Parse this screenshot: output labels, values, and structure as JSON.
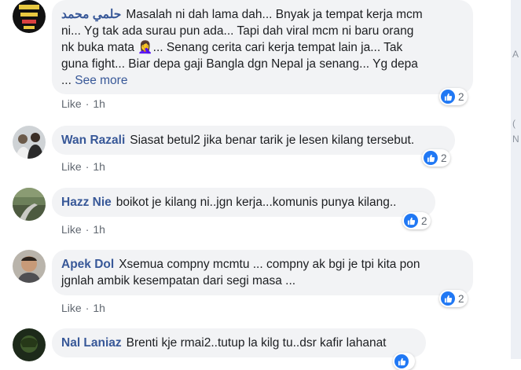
{
  "comments": [
    {
      "author": "حلمي محمد",
      "text_line1": "Masalah ni dah lama dah... Bnyak ja tempat kerja mcm",
      "text_line2": "ni... Yg tak ada surau pun ada... Tapi dah viral mcm ni baru orang",
      "text_line3a": "nk buka mata ",
      "emoji": "🤦‍♀️",
      "text_line3b": "... Senang cerita cari kerja tempat lain ja... Tak",
      "text_line4": "guna fight... Biar depa gaji Bangla dgn Nepal ja senang... Yg depa",
      "text_line5": "...",
      "see_more": "See more",
      "like": "Like",
      "time": "1h",
      "reaction_count": "2"
    },
    {
      "author": "Wan Razali",
      "text": "Siasat betul2 jika benar tarik je lesen kilang tersebut.",
      "like": "Like",
      "time": "1h",
      "reaction_count": "2"
    },
    {
      "author": "Hazz Nie",
      "text": "boikot je kilang ni..jgn kerja...komunis punya kilang..",
      "like": "Like",
      "time": "1h",
      "reaction_count": "2"
    },
    {
      "author": "Apek Dol",
      "text_line1": "Xsemua compny mcmtu ... compny ak bgi je tpi kita pon",
      "text_line2": "jgnlah ambik kesempatan dari segi masa ...",
      "like": "Like",
      "time": "1h",
      "reaction_count": "2"
    },
    {
      "author": "Nal Laniaz",
      "text": "Brenti kje rmai2..tutup la kilg tu..dsr kafir lahanat"
    }
  ],
  "sep": "·",
  "colors": {
    "link": "#385898",
    "bubble": "#f2f3f5",
    "like_blue": "#2078f4",
    "meta_gray": "#606770"
  },
  "icons": {
    "reaction": "thumbs-up-icon"
  }
}
